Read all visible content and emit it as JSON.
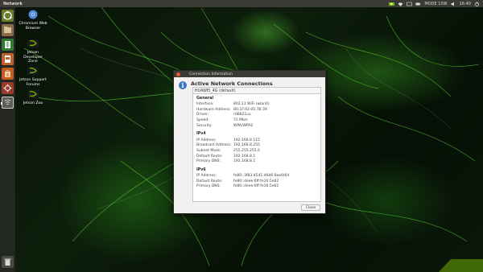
{
  "top_panel": {
    "app_title": "Network",
    "mode_label": "MODE 15W",
    "clock": "16:40",
    "tray_icons": [
      "nvidia-icon",
      "wifi-icon",
      "keyboard-icon",
      "battery-icon",
      "volume-icon",
      "power-icon"
    ]
  },
  "launcher": {
    "items": [
      "ubuntu-dash-icon",
      "files-icon",
      "spreadsheet-icon",
      "presentation-icon",
      "software-center-icon",
      "settings-icon",
      "network-icon",
      "trash-icon"
    ]
  },
  "desktop_icons": [
    {
      "label": "Chromium Web Browser",
      "icon": "chromium-icon"
    },
    {
      "label": "Jetson Developer Zone",
      "icon": "nvidia-icon"
    },
    {
      "label": "Jetson Support Forums",
      "icon": "nvidia-icon"
    },
    {
      "label": "Jetson Zoo",
      "icon": "nvidia-icon"
    }
  ],
  "dialog": {
    "window_title": "Connection Information",
    "heading": "Active Network Connections",
    "tab_label": "HUAWEI_4G (default)",
    "sections": {
      "general": {
        "title": "General",
        "rows": [
          {
            "k": "Interface:",
            "v": "802.11 WiFi (wlan0)"
          },
          {
            "k": "Hardware Address:",
            "v": "B0:1F:02:05:7B:39"
          },
          {
            "k": "Driver:",
            "v": "rtl8821cu"
          },
          {
            "k": "Speed:",
            "v": "72 Mb/s"
          },
          {
            "k": "Security:",
            "v": "WPA/WPA2"
          }
        ]
      },
      "ipv4": {
        "title": "IPv4",
        "rows": [
          {
            "k": "IP Address:",
            "v": "192.168.8.115"
          },
          {
            "k": "Broadcast Address:",
            "v": "192.168.8.255"
          },
          {
            "k": "Subnet Mask:",
            "v": "255.255.255.0"
          },
          {
            "k": "Default Route:",
            "v": "192.168.8.1"
          },
          {
            "k": "Primary DNS:",
            "v": "192.168.8.1"
          }
        ]
      },
      "ipv6": {
        "title": "IPv6",
        "rows": [
          {
            "k": "IP Address:",
            "v": "fe80::3f83:4541:46d6:8ae0/64"
          },
          {
            "k": "Default Route:",
            "v": "fe80::deee:6ff:fe16:5e62"
          },
          {
            "k": "Primary DNS:",
            "v": "fe80::deee:6ff:fe16:5e62"
          }
        ]
      }
    },
    "close_label": "Close"
  },
  "colors": {
    "accent_green": "#76b900",
    "panel_bg": "#3b3a36",
    "close_orange": "#e05a2b",
    "info_blue": "#3b73c6"
  }
}
